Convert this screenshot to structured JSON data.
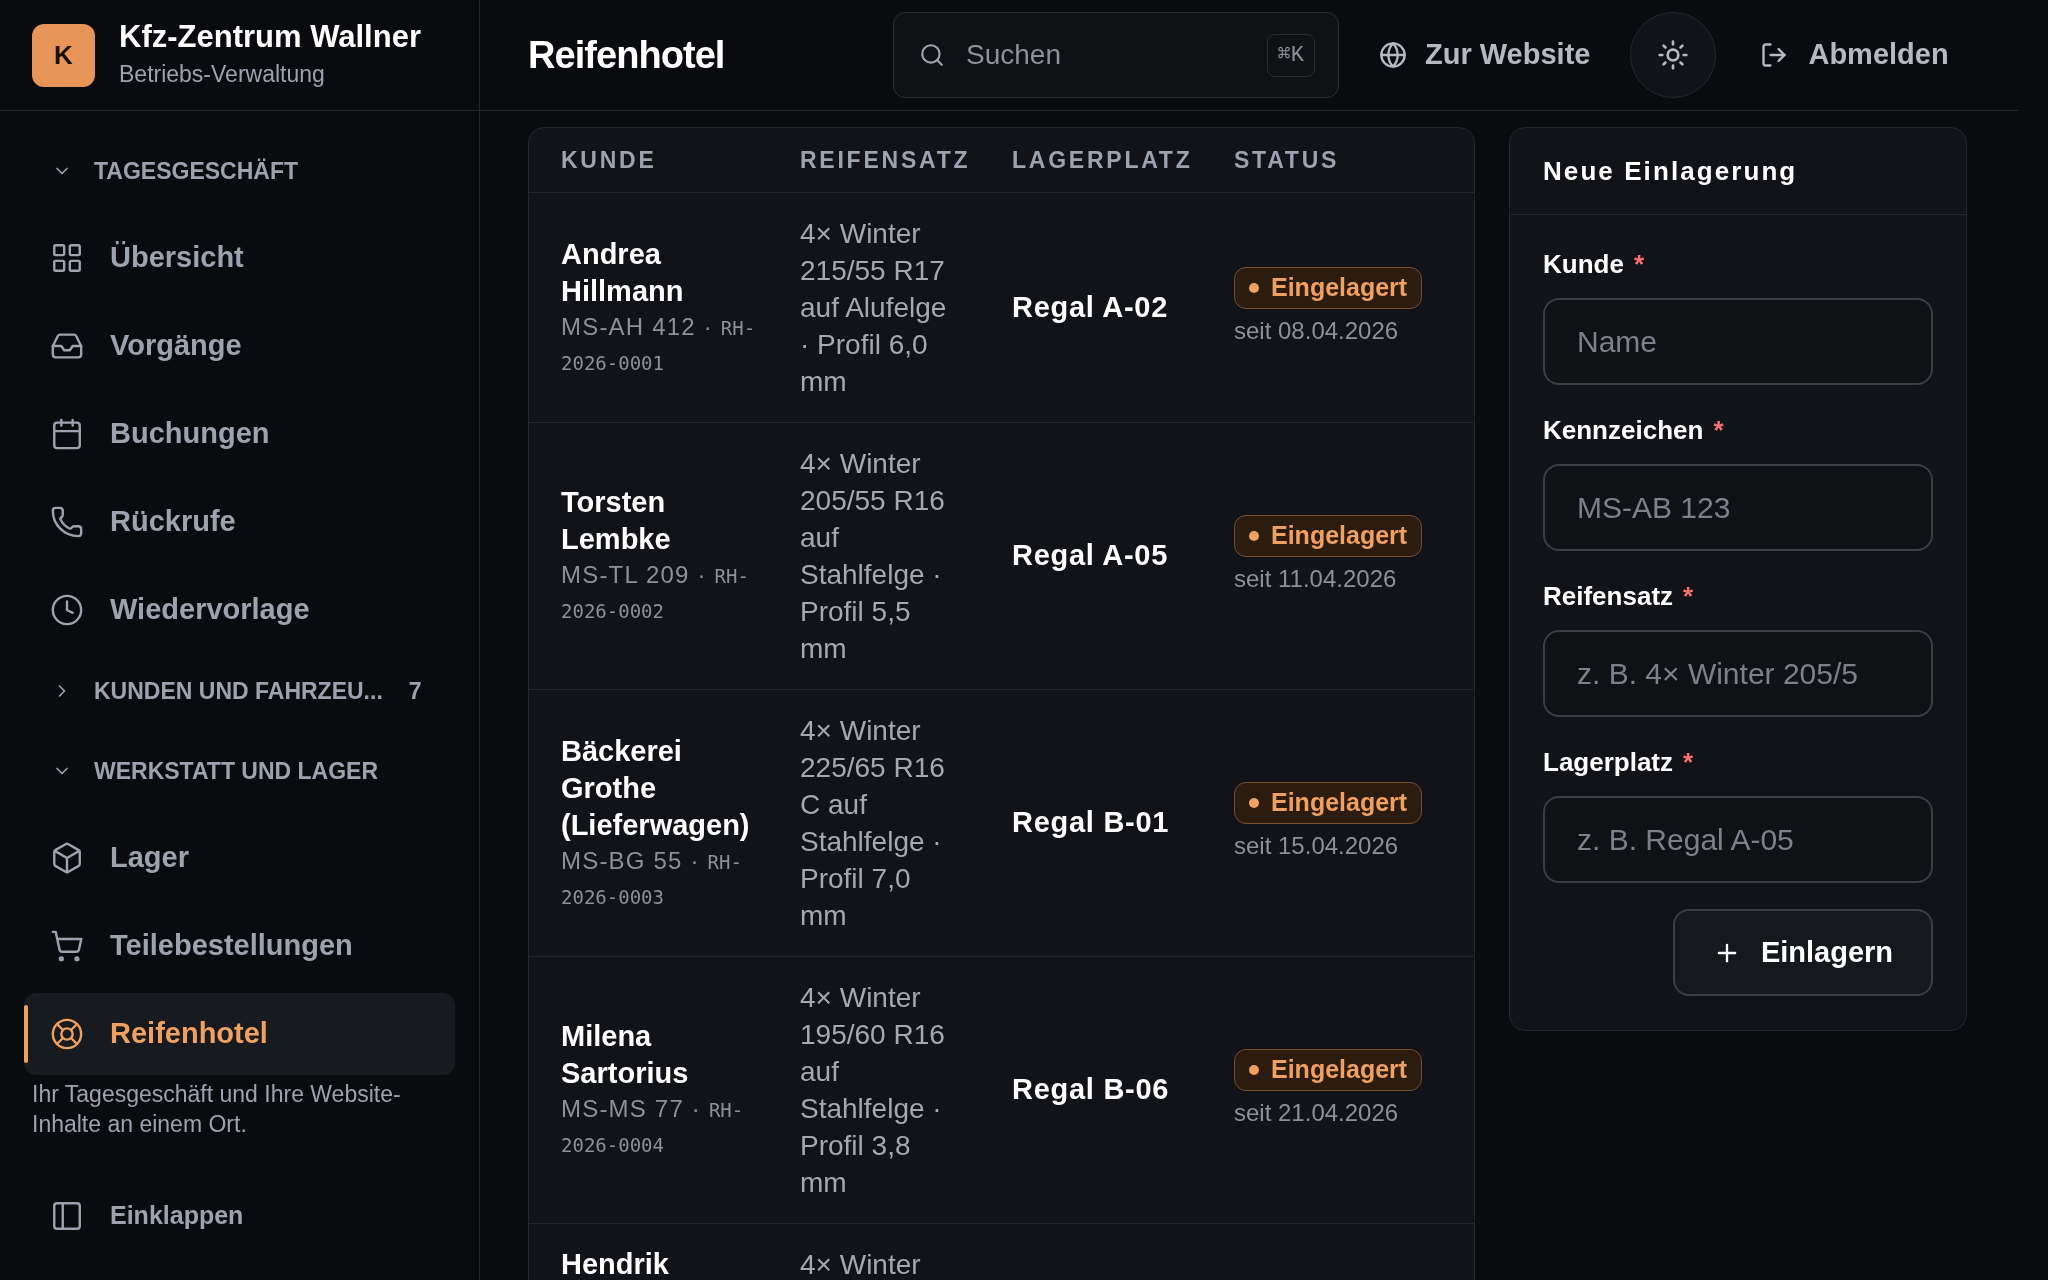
{
  "brand": {
    "initial": "K",
    "name": "Kfz-Zentrum Wallner",
    "subtitle": "Betriebs-Verwaltung"
  },
  "sidebar": {
    "sections": [
      {
        "title": "TAGESGESCHÄFT",
        "expanded": true,
        "items": [
          {
            "label": "Übersicht",
            "selected": false
          },
          {
            "label": "Vorgänge",
            "selected": false
          },
          {
            "label": "Buchungen",
            "selected": false
          },
          {
            "label": "Rückrufe",
            "selected": false
          },
          {
            "label": "Wiedervorlage",
            "selected": false
          }
        ]
      },
      {
        "title": "KUNDEN UND FAHRZEU...",
        "count": "7",
        "expanded": false
      },
      {
        "title": "WERKSTATT UND LAGER",
        "expanded": true,
        "items": [
          {
            "label": "Lager",
            "selected": false
          },
          {
            "label": "Teilebestellungen",
            "selected": false
          },
          {
            "label": "Reifenhotel",
            "selected": true
          }
        ]
      }
    ],
    "description": "Ihr Tagesgeschäft und Ihre Website-Inhalte an einem Ort.",
    "collapse": "Einklappen"
  },
  "header": {
    "title": "Reifenhotel",
    "search": {
      "placeholder": "Suchen",
      "shortcut": "⌘K"
    },
    "website": "Zur Website",
    "logout": "Abmelden"
  },
  "table": {
    "columns": [
      "KUNDE",
      "REIFENSATZ",
      "LAGERPLATZ",
      "STATUS"
    ],
    "rows": [
      {
        "name": "Andrea Hillmann",
        "plate": "MS-AH 412 ·",
        "ref": "RH-2026-0001",
        "tires": "4× Winter 215/55 R17 auf Alufelge · Profil 6,0 mm",
        "location": "Regal A-02",
        "status": "Eingelagert",
        "since": "seit 08.04.2026"
      },
      {
        "name": "Torsten Lembke",
        "plate": "MS-TL 209 ·",
        "ref": "RH-2026-0002",
        "tires": "4× Winter 205/55 R16 auf Stahlfelge · Profil 5,5 mm",
        "location": "Regal A-05",
        "status": "Eingelagert",
        "since": "seit 11.04.2026"
      },
      {
        "name": "Bäckerei Grothe (Lieferwagen)",
        "plate": "MS-BG 55 ·",
        "ref": "RH-2026-0003",
        "tires": "4× Winter 225/65 R16 C auf Stahlfelge · Profil 7,0 mm",
        "location": "Regal B-01",
        "status": "Eingelagert",
        "since": "seit 15.04.2026"
      },
      {
        "name": "Milena Sartorius",
        "plate": "MS-MS 77 ·",
        "ref": "RH-2026-0004",
        "tires": "4× Winter 195/60 R16 auf Stahlfelge · Profil 3,8 mm",
        "location": "Regal B-06",
        "status": "Eingelagert",
        "since": "seit 21.04.2026"
      },
      {
        "name": "Hendrik",
        "tires": "4× Winter"
      }
    ]
  },
  "form": {
    "title": "Neue Einlagerung",
    "fields": [
      {
        "label": "Kunde",
        "required": "*",
        "placeholder": "Name"
      },
      {
        "label": "Kennzeichen",
        "required": "*",
        "placeholder": "MS-AB 123"
      },
      {
        "label": "Reifensatz",
        "required": "*",
        "placeholder": "z. B. 4× Winter 205/5"
      },
      {
        "label": "Lagerplatz",
        "required": "*",
        "placeholder": "z. B. Regal A-05"
      }
    ],
    "submit": "Einlagern"
  }
}
